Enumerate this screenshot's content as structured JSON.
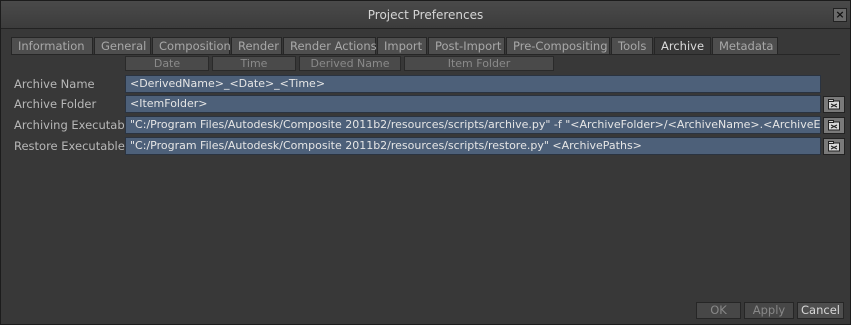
{
  "window": {
    "title": "Project Preferences",
    "close_label": "×"
  },
  "tabs": [
    {
      "label": "Information",
      "active": false
    },
    {
      "label": "General",
      "active": false
    },
    {
      "label": "Composition",
      "active": false
    },
    {
      "label": "Render",
      "active": false
    },
    {
      "label": "Render Actions",
      "active": false
    },
    {
      "label": "Import",
      "active": false
    },
    {
      "label": "Post-Import",
      "active": false
    },
    {
      "label": "Pre-Compositing",
      "active": false
    },
    {
      "label": "Tools",
      "active": false
    },
    {
      "label": "Archive",
      "active": true
    },
    {
      "label": "Metadata",
      "active": false
    }
  ],
  "tokens": [
    "Date",
    "Time",
    "Derived Name",
    "Item Folder"
  ],
  "fields": [
    {
      "label": "Archive Name",
      "value": "<DerivedName>_<Date>_<Time>",
      "has_browse": false
    },
    {
      "label": "Archive Folder",
      "value": "<ItemFolder>",
      "has_browse": true
    },
    {
      "label": "Archiving Executable",
      "value": "\"C:/Program Files/Autodesk/Composite 2011b2/resources/scripts/archive.py\" -f \"<ArchiveFolder>/<ArchiveName>.<ArchiveExt>\"",
      "has_browse": true
    },
    {
      "label": "Restore Executable",
      "value": "\"C:/Program Files/Autodesk/Composite 2011b2/resources/scripts/restore.py\" <ArchivePaths>",
      "has_browse": true
    }
  ],
  "browse_icon": "folder-browse-icon",
  "footer": {
    "ok_label": "OK",
    "apply_label": "Apply",
    "cancel_label": "Cancel"
  },
  "colors": {
    "field_bg": "#4d6079",
    "window_bg": "#383838"
  }
}
